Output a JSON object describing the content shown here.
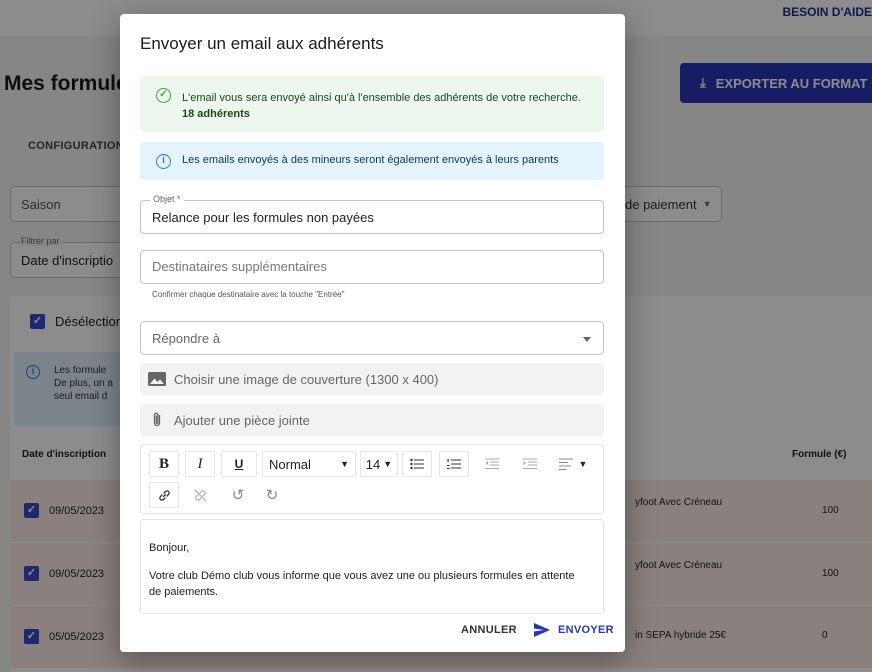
{
  "background": {
    "help_label": "BESOIN D'AIDE",
    "page_title": "Mes formule",
    "export_label": "EXPORTER AU FORMAT",
    "tab_label": "CONFIGURATION",
    "season_placeholder": "Saison",
    "payment_select": "de paiement",
    "filter_label": "Filtrer par",
    "filter_value": "Date d'inscriptio",
    "deselect_label": "Désélection",
    "info_lines": [
      "Les formule",
      "De plus, un a",
      "seul email d"
    ],
    "table_headers": {
      "date": "Date d'inscription",
      "formula": "Formule (€)"
    },
    "rows": [
      {
        "date": "09/05/2023",
        "name": "yfoot Avec Créneau",
        "price": "100"
      },
      {
        "date": "09/05/2023",
        "name": "yfoot Avec Créneau",
        "price": "100"
      },
      {
        "date": "05/05/2023",
        "name": "in SEPA hybride 25€",
        "price": "0"
      }
    ]
  },
  "modal": {
    "title": "Envoyer un email aux adhérents",
    "success_text": "L'email vous sera envoyé ainsi qu'à l'ensemble des adhérents de votre recherche.",
    "success_count": "18 adhérents",
    "info_text": "Les emails envoyés à des mineurs seront également envoyés à leurs parents",
    "subject_label": "Objet *",
    "subject_value": "Relance pour les formules non payées",
    "recipients_placeholder": "Destinataires supplémentaires",
    "recipients_helper": "Confirmer chaque destinataire avec la touche \"Entrée\"",
    "reply_to_placeholder": "Répondre à",
    "cover_label": "Choisir une image de couverture (1300 x 400)",
    "attachment_label": "Ajouter une pièce jointe",
    "toolbar": {
      "bold": "B",
      "italic": "I",
      "underline": "U",
      "style": "Normal",
      "size": "14"
    },
    "editor_lines": [
      "Bonjour,",
      "Votre club Démo club vous informe que vous avez une ou plusieurs formules en attente de paiements."
    ],
    "cancel_label": "ANNULER",
    "send_label": "ENVOYER"
  },
  "colors": {
    "primary": "#2836b8",
    "success_bg": "#edf7ed",
    "info_bg": "#e5f3fc",
    "row_highlight": "#fbeae6"
  }
}
